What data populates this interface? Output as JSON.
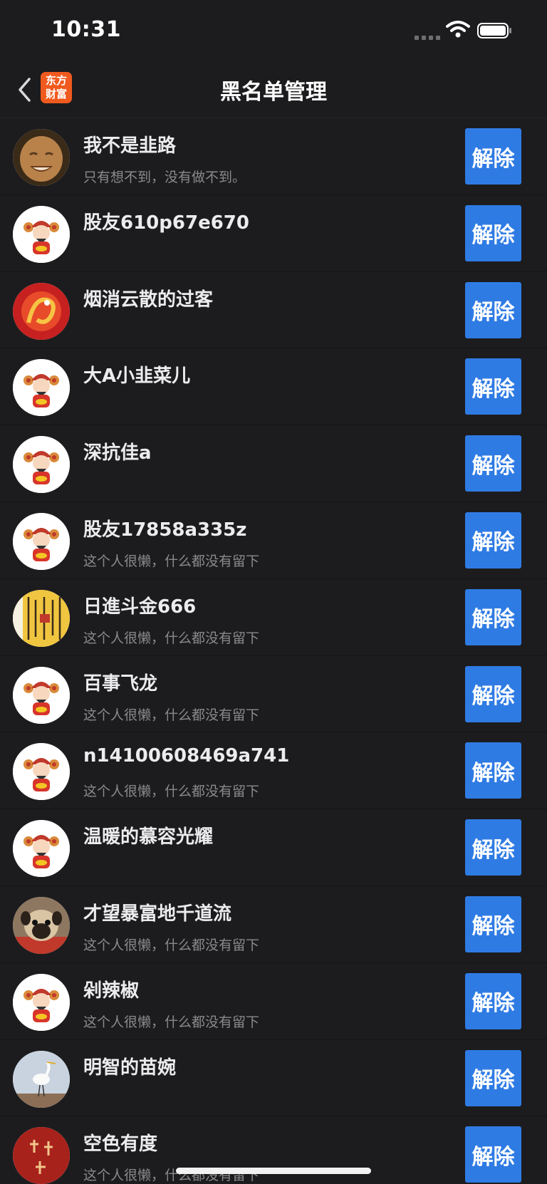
{
  "status_bar": {
    "time": "10:31"
  },
  "nav": {
    "title": "黑名单管理",
    "logo_line1": "东方",
    "logo_line2": "财富"
  },
  "remove_label": "解除",
  "users": [
    {
      "name": "我不是韭路",
      "signature": "只有想不到，没有做不到。",
      "avatar": "buddha"
    },
    {
      "name": "股友610p67e670",
      "signature": "",
      "avatar": "caishen"
    },
    {
      "name": "烟消云散的过客",
      "signature": "",
      "avatar": "dragon"
    },
    {
      "name": "大A小韭菜儿",
      "signature": "",
      "avatar": "caishen"
    },
    {
      "name": "深抗佳a",
      "signature": "",
      "avatar": "caishen"
    },
    {
      "name": "股友17858a335z",
      "signature": "这个人很懒，什么都没有留下",
      "avatar": "caishen"
    },
    {
      "name": "日進斗金666",
      "signature": "这个人很懒，什么都没有留下",
      "avatar": "calligraphy"
    },
    {
      "name": "百事飞龙",
      "signature": "这个人很懒，什么都没有留下",
      "avatar": "caishen"
    },
    {
      "name": "n14100608469a741",
      "signature": "这个人很懒，什么都没有留下",
      "avatar": "caishen"
    },
    {
      "name": "温暖的慕容光耀",
      "signature": "",
      "avatar": "caishen"
    },
    {
      "name": "才望暴富地千道流",
      "signature": "这个人很懒，什么都没有留下",
      "avatar": "pug"
    },
    {
      "name": "剁辣椒",
      "signature": "这个人很懒，什么都没有留下",
      "avatar": "caishen"
    },
    {
      "name": "明智的苗婉",
      "signature": "",
      "avatar": "bird"
    },
    {
      "name": "空色有度",
      "signature": "这个人很懒，什么都没有留下",
      "avatar": "tea"
    }
  ],
  "colors": {
    "background": "#1c1c1e",
    "button": "#2f7be4",
    "logo": "#f05a1e"
  },
  "icons": [
    "back-chevron-icon",
    "wifi-icon",
    "battery-icon",
    "signal-icon"
  ]
}
